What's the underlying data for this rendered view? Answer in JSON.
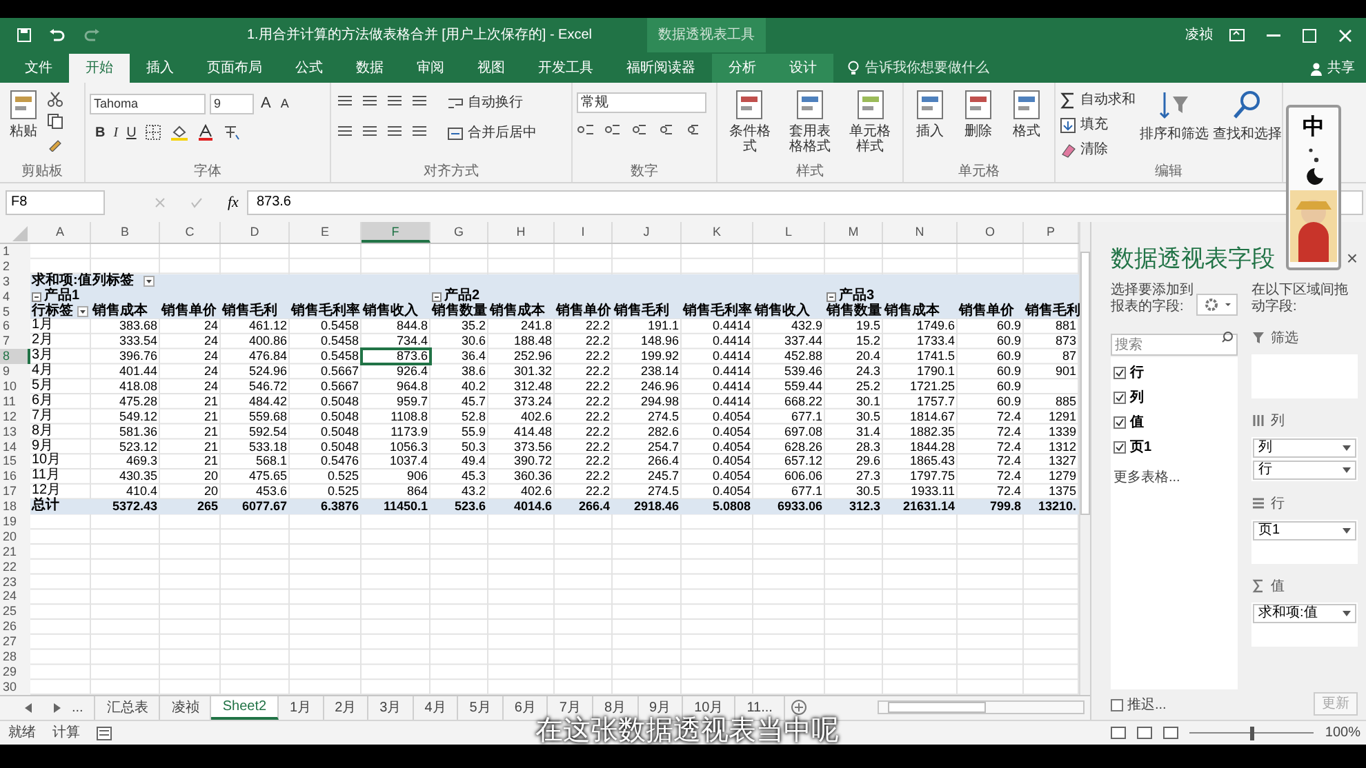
{
  "title_bar": {
    "title": "1.用合并计算的方法做表格合并 [用户上次保存的]  -  Excel",
    "context_group": "数据透视表工具",
    "user": "凌祯"
  },
  "ribbon_tabs": [
    {
      "label": "文件",
      "selected": false
    },
    {
      "label": "开始",
      "selected": true
    },
    {
      "label": "插入",
      "selected": false
    },
    {
      "label": "页面布局",
      "selected": false
    },
    {
      "label": "公式",
      "selected": false
    },
    {
      "label": "数据",
      "selected": false
    },
    {
      "label": "审阅",
      "selected": false
    },
    {
      "label": "视图",
      "selected": false
    },
    {
      "label": "开发工具",
      "selected": false
    },
    {
      "label": "福昕阅读器",
      "selected": false
    },
    {
      "label": "分析",
      "selected": false
    },
    {
      "label": "设计",
      "selected": false
    }
  ],
  "tell_me": "告诉我你想要做什么",
  "share": "共享",
  "ribbon": {
    "clipboard": {
      "paste": "粘贴",
      "label": "剪贴板"
    },
    "font": {
      "name": "Tahoma",
      "size": "9",
      "grow": "A",
      "shrink": "A",
      "bold": "B",
      "italic": "I",
      "underline": "U",
      "label": "字体"
    },
    "alignment": {
      "wrap": "自动换行",
      "merge": "合并后居中",
      "label": "对齐方式"
    },
    "number": {
      "format": "常规",
      "label": "数字"
    },
    "styles": {
      "buttons": [
        "条件格式",
        "套用表格格式",
        "单元格样式"
      ],
      "label": "样式"
    },
    "cells": {
      "buttons": [
        "插入",
        "删除",
        "格式"
      ],
      "label": "单元格"
    },
    "editing": {
      "small": [
        "自动求和",
        "填充",
        "清除"
      ],
      "large": [
        "排序和筛选",
        "查找和选择"
      ],
      "label": "编辑"
    }
  },
  "formula_bar": {
    "name_box": "F8",
    "fx": "fx",
    "value": "873.6"
  },
  "columns": [
    {
      "label": "A",
      "selected": false
    },
    {
      "label": "B",
      "selected": false
    },
    {
      "label": "C",
      "selected": false
    },
    {
      "label": "D",
      "selected": false
    },
    {
      "label": "E",
      "selected": false
    },
    {
      "label": "F",
      "selected": true
    },
    {
      "label": "G",
      "selected": false
    },
    {
      "label": "H",
      "selected": false
    },
    {
      "label": "I",
      "selected": false
    },
    {
      "label": "J",
      "selected": false
    },
    {
      "label": "K",
      "selected": false
    },
    {
      "label": "L",
      "selected": false
    },
    {
      "label": "M",
      "selected": false
    },
    {
      "label": "N",
      "selected": false
    },
    {
      "label": "O",
      "selected": false
    },
    {
      "label": "P",
      "selected": false
    }
  ],
  "row_numbers": [
    "1",
    "2",
    "3",
    "4",
    "5",
    "6",
    "7",
    "8",
    "9",
    "10",
    "11",
    "12",
    "13",
    "14",
    "15",
    "16",
    "17",
    "18",
    "19",
    "20",
    "21",
    "22",
    "23",
    "24",
    "25",
    "26",
    "27",
    "28",
    "29",
    "30"
  ],
  "pivot": {
    "value_label": "求和项:值",
    "column_label": "列标签",
    "row_label": "行标签",
    "products": [
      "产品1",
      "产品2",
      "产品3"
    ],
    "fields": [
      "销售成本",
      "销售单价",
      "销售毛利",
      "销售毛利率",
      "销售收入",
      "销售数量",
      "销售成本",
      "销售单价",
      "销售毛利",
      "销售毛利率",
      "销售收入",
      "销售数量",
      "销售成本",
      "销售单价",
      "销售毛利"
    ],
    "rows": [
      {
        "label": "1月",
        "selected": false,
        "values": [
          "383.68",
          "24",
          "461.12",
          "0.5458",
          "844.8",
          "35.2",
          "241.8",
          "22.2",
          "191.1",
          "0.4414",
          "432.9",
          "19.5",
          "1749.6",
          "60.9",
          "881"
        ]
      },
      {
        "label": "2月",
        "selected": false,
        "values": [
          "333.54",
          "24",
          "400.86",
          "0.5458",
          "734.4",
          "30.6",
          "188.48",
          "22.2",
          "148.96",
          "0.4414",
          "337.44",
          "15.2",
          "1733.4",
          "60.9",
          "873"
        ]
      },
      {
        "label": "3月",
        "selected": true,
        "values": [
          "396.76",
          "24",
          "476.84",
          "0.5458",
          "873.6",
          "36.4",
          "252.96",
          "22.2",
          "199.92",
          "0.4414",
          "452.88",
          "20.4",
          "1741.5",
          "60.9",
          "87"
        ]
      },
      {
        "label": "4月",
        "selected": false,
        "values": [
          "401.44",
          "24",
          "524.96",
          "0.5667",
          "926.4",
          "38.6",
          "301.32",
          "22.2",
          "238.14",
          "0.4414",
          "539.46",
          "24.3",
          "1790.1",
          "60.9",
          "901"
        ]
      },
      {
        "label": "5月",
        "selected": false,
        "values": [
          "418.08",
          "24",
          "546.72",
          "0.5667",
          "964.8",
          "40.2",
          "312.48",
          "22.2",
          "246.96",
          "0.4414",
          "559.44",
          "25.2",
          "1721.25",
          "60.9"
        ]
      },
      {
        "label": "6月",
        "selected": false,
        "values": [
          "475.28",
          "21",
          "484.42",
          "0.5048",
          "959.7",
          "45.7",
          "373.24",
          "22.2",
          "294.98",
          "0.4414",
          "668.22",
          "30.1",
          "1757.7",
          "60.9",
          "885"
        ]
      },
      {
        "label": "7月",
        "selected": false,
        "values": [
          "549.12",
          "21",
          "559.68",
          "0.5048",
          "1108.8",
          "52.8",
          "402.6",
          "22.2",
          "274.5",
          "0.4054",
          "677.1",
          "30.5",
          "1814.67",
          "72.4",
          "1291"
        ]
      },
      {
        "label": "8月",
        "selected": false,
        "values": [
          "581.36",
          "21",
          "592.54",
          "0.5048",
          "1173.9",
          "55.9",
          "414.48",
          "22.2",
          "282.6",
          "0.4054",
          "697.08",
          "31.4",
          "1882.35",
          "72.4",
          "1339"
        ]
      },
      {
        "label": "9月",
        "selected": false,
        "values": [
          "523.12",
          "21",
          "533.18",
          "0.5048",
          "1056.3",
          "50.3",
          "373.56",
          "22.2",
          "254.7",
          "0.4054",
          "628.26",
          "28.3",
          "1844.28",
          "72.4",
          "1312"
        ]
      },
      {
        "label": "10月",
        "selected": false,
        "values": [
          "469.3",
          "21",
          "568.1",
          "0.5476",
          "1037.4",
          "49.4",
          "390.72",
          "22.2",
          "266.4",
          "0.4054",
          "657.12",
          "29.6",
          "1865.43",
          "72.4",
          "1327"
        ]
      },
      {
        "label": "11月",
        "selected": false,
        "values": [
          "430.35",
          "20",
          "475.65",
          "0.525",
          "906",
          "45.3",
          "360.36",
          "22.2",
          "245.7",
          "0.4054",
          "606.06",
          "27.3",
          "1797.75",
          "72.4",
          "1279"
        ]
      },
      {
        "label": "12月",
        "selected": false,
        "values": [
          "410.4",
          "20",
          "453.6",
          "0.525",
          "864",
          "43.2",
          "402.6",
          "22.2",
          "274.5",
          "0.4054",
          "677.1",
          "30.5",
          "1933.11",
          "72.4",
          "1375"
        ]
      }
    ],
    "total": {
      "label": "总计",
      "values": [
        "5372.43",
        "265",
        "6077.67",
        "6.3876",
        "11450.1",
        "523.6",
        "4014.6",
        "266.4",
        "2918.46",
        "5.0808",
        "6933.06",
        "312.3",
        "21631.14",
        "799.8",
        "13210."
      ]
    }
  },
  "field_pane": {
    "title": "数据透视表字段",
    "close": "×",
    "choose_label": "选择要添加到报表的字段:",
    "search_placeholder": "搜索",
    "fields": [
      {
        "label": "行",
        "checked": true
      },
      {
        "label": "列",
        "checked": true
      },
      {
        "label": "值",
        "checked": true
      },
      {
        "label": "页1",
        "checked": true
      }
    ],
    "more_tables": "更多表格...",
    "drag_label": "在以下区域间拖动字段:",
    "areas": [
      {
        "kind": "filter",
        "label": "筛选"
      },
      {
        "kind": "columns",
        "label": "列",
        "items": [
          "列",
          "行"
        ]
      },
      {
        "kind": "rows",
        "label": "行",
        "items": [
          "页1"
        ]
      },
      {
        "kind": "values",
        "label": "值",
        "items": [
          "求和项:值"
        ]
      }
    ],
    "defer": {
      "label": "推迟...",
      "checked": false
    },
    "update_button": "更新"
  },
  "sheet_tabs": [
    {
      "label": "...",
      "selected": false
    },
    {
      "label": "汇总表",
      "selected": false
    },
    {
      "label": "凌祯",
      "selected": false
    },
    {
      "label": "Sheet2",
      "selected": true
    },
    {
      "label": "1月",
      "selected": false
    },
    {
      "label": "2月",
      "selected": false
    },
    {
      "label": "3月",
      "selected": false
    },
    {
      "label": "4月",
      "selected": false
    },
    {
      "label": "5月",
      "selected": false
    },
    {
      "label": "6月",
      "selected": false
    },
    {
      "label": "7月",
      "selected": false
    },
    {
      "label": "8月",
      "selected": false
    },
    {
      "label": "9月",
      "selected": false
    },
    {
      "label": "10月",
      "selected": false
    },
    {
      "label": "11...",
      "selected": false
    }
  ],
  "status_bar": {
    "items": [
      "就绪",
      "计算"
    ],
    "zoom": "100%",
    "zoom_slider": {
      "level": 0.5
    }
  },
  "ime": {
    "mode": "中"
  },
  "subtitle": "在这张数据透视表当中呢"
}
